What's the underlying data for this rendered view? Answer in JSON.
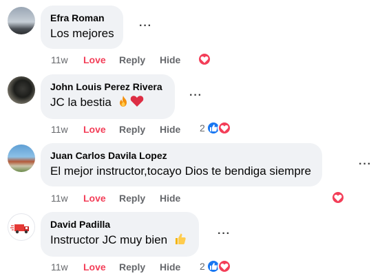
{
  "actions": {
    "love": "Love",
    "reply": "Reply",
    "hide": "Hide"
  },
  "comments": [
    {
      "author": "Efra Roman",
      "text": "Los mejores",
      "time": "11w",
      "reactions": [
        "love"
      ],
      "count": ""
    },
    {
      "author": "John Louis Perez Rivera",
      "text": "JC la bestia",
      "time": "11w",
      "reactions": [
        "like",
        "love"
      ],
      "count": "2",
      "emojis": [
        "fire-emoji",
        "red-heart-emoji"
      ]
    },
    {
      "author": "Juan Carlos Davila Lopez",
      "text": "El mejor instructor,tocayo Dios te bendiga siempre",
      "time": "11w",
      "reactions": [
        "love"
      ],
      "count": ""
    },
    {
      "author": "David Padilla",
      "text": "Instructor JC muy bien",
      "time": "11w",
      "reactions": [
        "like",
        "love"
      ],
      "count": "2",
      "emojis": [
        "thumbs-up-emoji"
      ]
    }
  ],
  "colors": {
    "love": "#f33e58",
    "like": "#1877f2",
    "bubble": "#f0f2f5",
    "meta": "#65676b"
  }
}
